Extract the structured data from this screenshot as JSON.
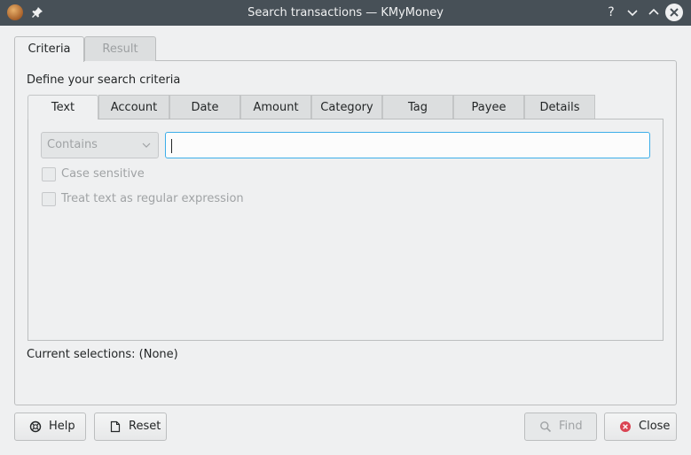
{
  "window": {
    "title": "Search transactions — KMyMoney"
  },
  "titlebar_buttons": {
    "help": "?",
    "minimize": "⌄",
    "maximize": "⌃"
  },
  "outer_tabs": [
    {
      "label": "Criteria"
    },
    {
      "label": "Result"
    }
  ],
  "criteria": {
    "heading": "Define your search criteria",
    "tabs": [
      {
        "label": "Text"
      },
      {
        "label": "Account"
      },
      {
        "label": "Date"
      },
      {
        "label": "Amount"
      },
      {
        "label": "Category"
      },
      {
        "label": "Tag"
      },
      {
        "label": "Payee"
      },
      {
        "label": "Details"
      }
    ],
    "text_tab": {
      "match_mode": "Contains",
      "search_value": "",
      "case_sensitive_label": "Case sensitive",
      "regex_label": "Treat text as regular expression"
    },
    "current_selections": "Current selections: (None)"
  },
  "buttons": {
    "help": "Help",
    "reset": "Reset",
    "find": "Find",
    "close": "Close"
  },
  "colors": {
    "titlebar": "#475057",
    "focus": "#3daee9",
    "close_icon": "#da4453"
  }
}
